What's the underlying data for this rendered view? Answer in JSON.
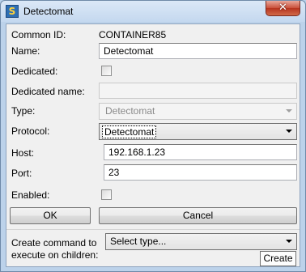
{
  "window": {
    "title": "Detectomat",
    "app_icon_letter": "S",
    "close_symbol": "✕"
  },
  "form": {
    "common_id_label": "Common ID:",
    "common_id_value": "CONTAINER85",
    "name_label": "Name:",
    "name_value": "Detectomat",
    "dedicated_label": "Dedicated:",
    "dedicated_checked": false,
    "dedicated_name_label": "Dedicated name:",
    "dedicated_name_value": "",
    "type_label": "Type:",
    "type_value": "Detectomat",
    "protocol_label": "Protocol:",
    "protocol_value": "Detectomat",
    "host_label": "Host:",
    "host_value": "192.168.1.23",
    "port_label": "Port:",
    "port_value": "23",
    "enabled_label": "Enabled:",
    "enabled_checked": false
  },
  "buttons": {
    "ok": "OK",
    "cancel": "Cancel",
    "create": "Create"
  },
  "children": {
    "label_line1": "Create command to",
    "label_line2": "execute on children:",
    "select_value": "Select type..."
  },
  "icons": {
    "app": "app-icon",
    "close": "close-icon",
    "dropdown": "chevron-down-icon"
  },
  "colors": {
    "title_bar": "#c4d8ef",
    "close_button": "#c9503a",
    "client_bg": "#f0f0f0"
  }
}
